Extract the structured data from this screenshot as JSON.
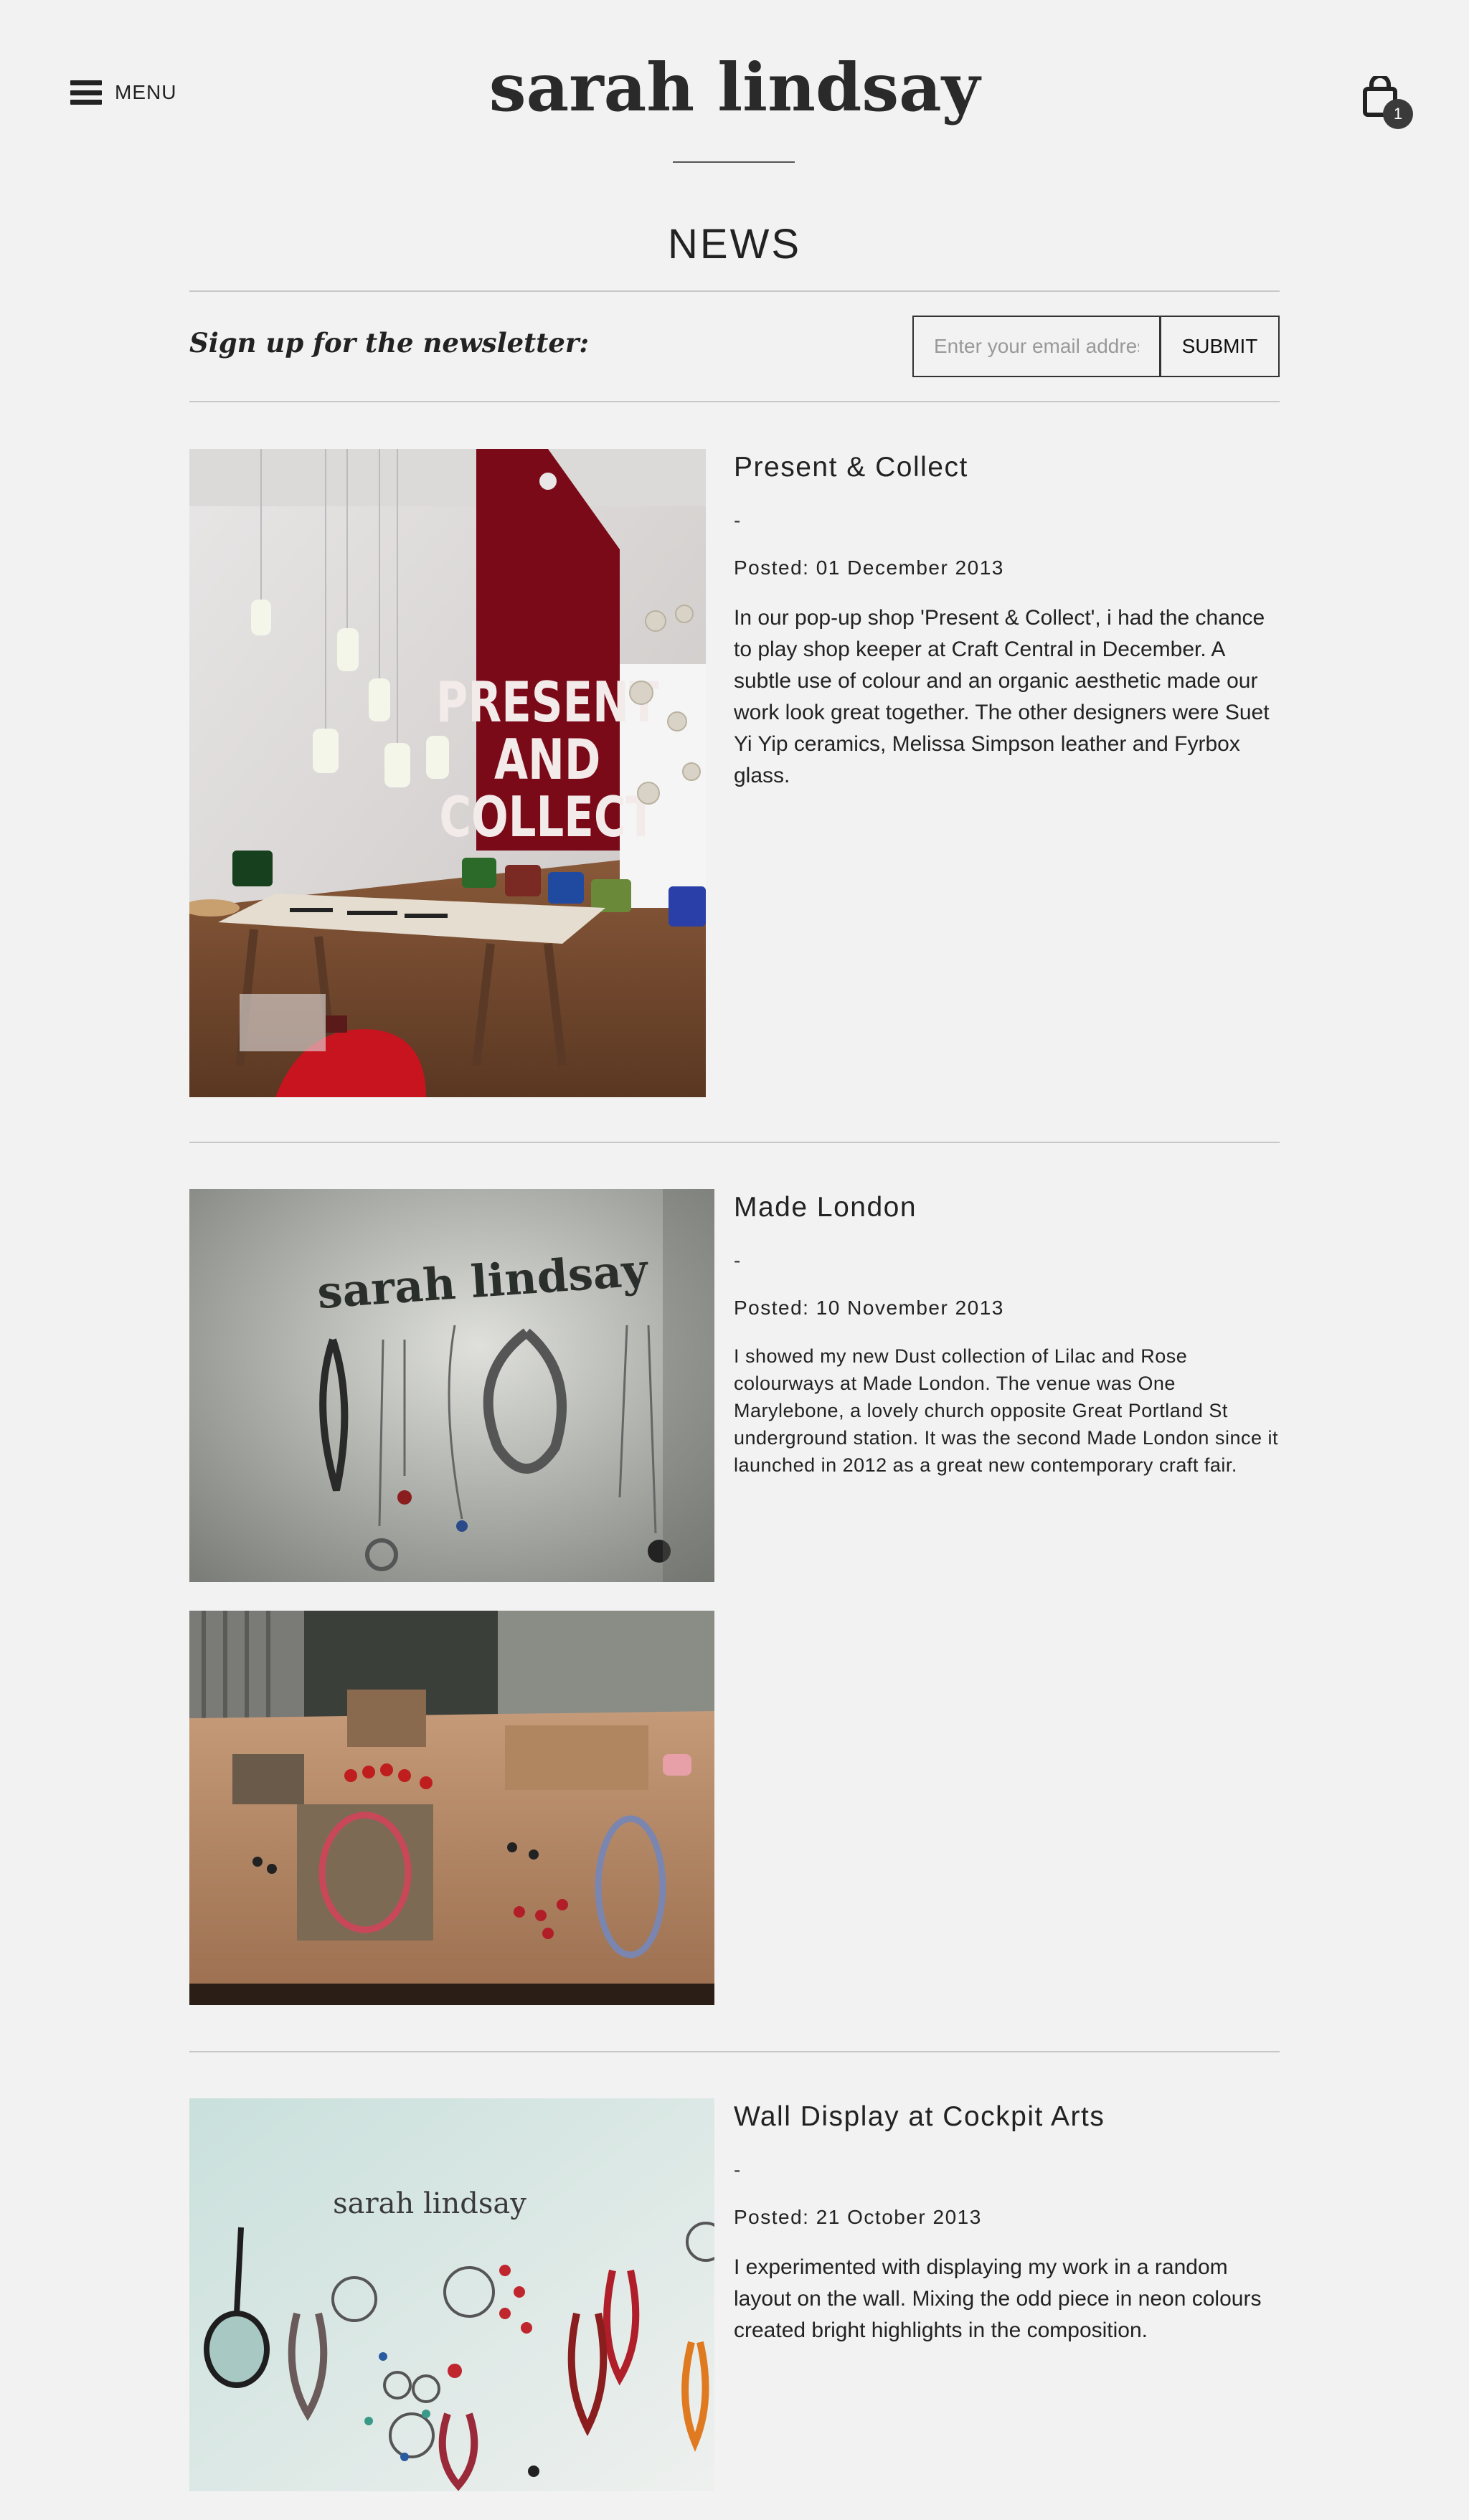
{
  "header": {
    "menu_label": "MENU",
    "brand": "sarah lindsay",
    "cart_count": "1"
  },
  "page": {
    "title": "NEWS"
  },
  "newsletter": {
    "label": "Sign up for the newsletter:",
    "placeholder": "Enter your email address",
    "submit": "SUBMIT"
  },
  "posts": [
    {
      "title": "Present & Collect",
      "dash": "-",
      "date": "Posted: 01 December 2013",
      "body": "In our pop-up shop 'Present & Collect', i had the chance to play shop keeper at Craft Central in December.  A subtle use of colour and an organic aesthetic made our work look great together.  The other designers were Suet Yi Yip ceramics, Melissa Simpson leather and Fyrbox glass.",
      "image_sign": "PRESENT AND COLLECT"
    },
    {
      "title": "Made London",
      "dash": "-",
      "date": "Posted: 10 November 2013",
      "body": "I showed my new Dust collection of Lilac and Rose colourways at Made London.  The venue was One Marylebone, a lovely church opposite Great Portland St underground station.  It was the second Made London since it launched in 2012 as a great new contemporary craft fair.",
      "image_wall_text": "sarah lindsay"
    },
    {
      "title": "Wall Display at Cockpit Arts",
      "dash": "-",
      "date": "Posted: 21 October 2013",
      "body": "I experimented with displaying my work in a random layout on the wall.  Mixing the odd piece in neon colours created bright highlights in the composition.",
      "image_wall_text": "sarah lindsay"
    }
  ],
  "colors": {
    "background": "#f2f2f2",
    "text": "#222222",
    "rule": "#c8c8c8",
    "sign_red": "#7a0a18"
  },
  "icons": [
    "hamburger-icon",
    "shopping-bag-icon"
  ]
}
